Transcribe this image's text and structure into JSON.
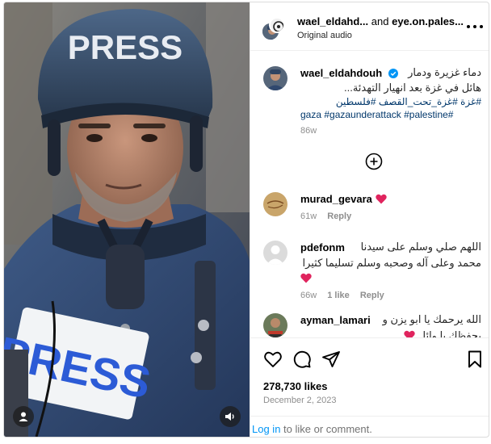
{
  "post": {
    "header": {
      "user_primary": "wael_eldahd...",
      "conjunction": "and",
      "user_secondary": "eye.on.pales...",
      "subtitle": "Original audio",
      "more_icon": "more-horizontal-icon"
    },
    "media": {
      "overlay_text_helmet": "PRESS",
      "overlay_text_vest": "PRESS",
      "tag_users_icon": "user-icon",
      "audio_icon": "speaker-icon"
    },
    "caption": {
      "username": "wael_eldahdouh",
      "verified": true,
      "text_line1": "دماء غزيرة ودمار",
      "text_line2": "هائل في غزة بعد انهيار التهدئة...",
      "hashtags_line1": "#غزة #غزة_تحت_القصف #فلسطين",
      "hashtags_line2": "gaza #gazaunderattack #palestine#",
      "time": "86w"
    },
    "load_more_icon": "plus-circle-icon",
    "comments": [
      {
        "username": "murad_gevara",
        "text": "",
        "has_heart": true,
        "time": "61w",
        "likes": "",
        "reply": "Reply"
      },
      {
        "username": "pdefonm",
        "text_line1": "اللهم صلي وسلم على سيدنا",
        "text_line2": "محمد وعلى آله وصحبه وسلم تسليما كثيرا",
        "has_heart": true,
        "time": "66w",
        "likes": "1 like",
        "reply": "Reply"
      },
      {
        "username": "ayman_lamari",
        "text_line1": "الله يرحمك يا ابو يزن و",
        "text_line2": "يحفظك يا وائل",
        "has_heart": true
      }
    ],
    "actions": {
      "like_icon": "heart-icon",
      "comment_icon": "comment-icon",
      "share_icon": "send-icon",
      "save_icon": "bookmark-icon"
    },
    "likes_count": "278,730 likes",
    "date": "December 2, 2023",
    "login": {
      "link": "Log in",
      "rest": " to like or comment."
    }
  },
  "colors": {
    "link_blue": "#0095f6",
    "hashtag_blue": "#00376b",
    "verified_blue": "#0095f6",
    "heart_red": "#ed4956",
    "meta_gray": "#8e8e8e",
    "border": "#dbdbdb"
  }
}
